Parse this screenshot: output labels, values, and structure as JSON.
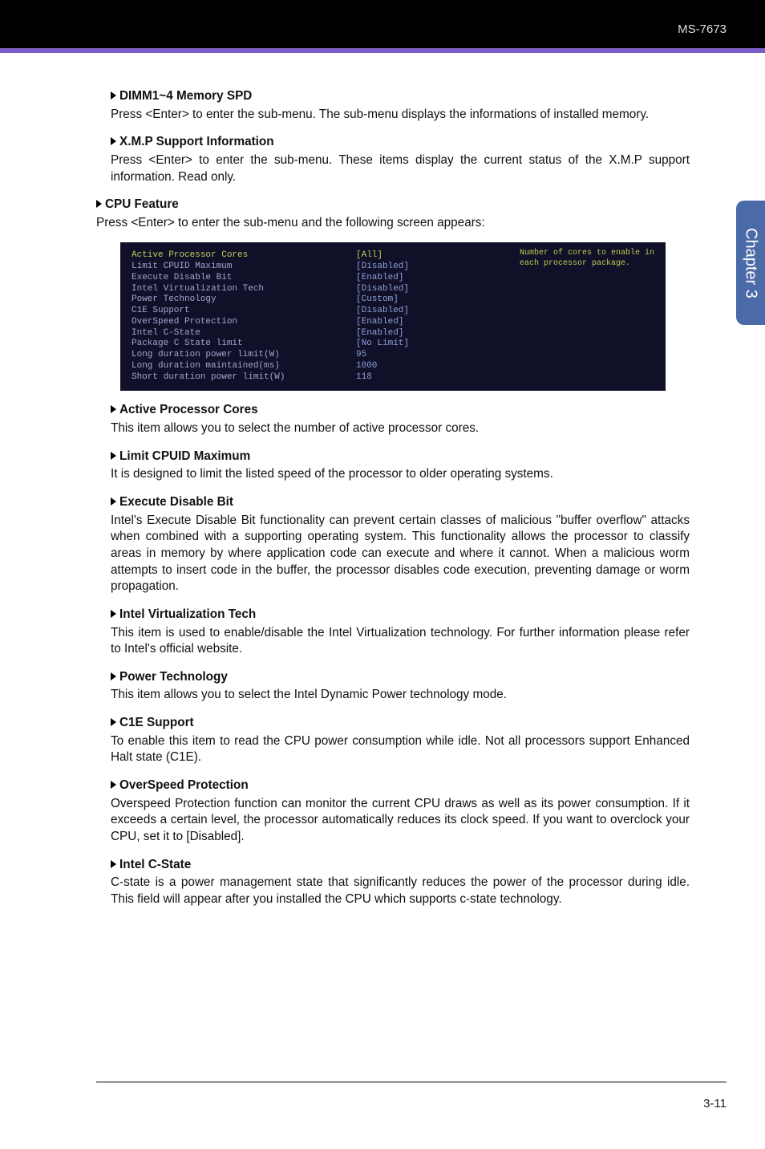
{
  "header": {
    "model": "MS-7673"
  },
  "sidebar": {
    "label": "Chapter 3"
  },
  "sections": {
    "dimm": {
      "title": "DIMM1~4 Memory SPD",
      "body": "Press <Enter> to enter the sub-menu. The sub-menu displays the informations of installed memory."
    },
    "xmp": {
      "title": "X.M.P Support Information",
      "body": "Press <Enter> to enter the sub-menu. These items display the current status of the X.M.P support information. Read only."
    },
    "cpu_feature": {
      "title": "CPU Feature",
      "body": "Press <Enter> to enter the sub-menu and the following screen appears:"
    },
    "active_cores": {
      "title": "Active Processor Cores",
      "body": "This item allows you to select the number of active processor cores."
    },
    "limit_cpuid": {
      "title": "Limit CPUID Maximum",
      "body": "It is designed to limit the listed speed of the processor to older operating systems."
    },
    "exec_disable": {
      "title": "Execute Disable Bit",
      "body": "Intel's Execute Disable Bit functionality can prevent certain classes of malicious \"buffer overflow\" attacks when combined with a supporting operating system. This functionality allows the processor to classify areas in memory by where application code can execute and where it cannot. When a malicious worm attempts to insert code in the buffer, the processor disables code execution, preventing damage or worm propagation."
    },
    "intel_virt": {
      "title": "Intel Virtualization Tech",
      "body": "This item is used to enable/disable the Intel Virtualization technology. For further information please refer to Intel's official website."
    },
    "power_tech": {
      "title": "Power Technology",
      "body": "This item allows you to select the Intel Dynamic Power technology mode."
    },
    "c1e": {
      "title": "C1E Support",
      "body": "To enable this item to read the CPU power consumption while idle. Not all processors support Enhanced Halt state (C1E)."
    },
    "overspeed": {
      "title": "OverSpeed Protection",
      "body": "Overspeed Protection function can monitor the current CPU draws as well as its power consumption. If it exceeds a certain level, the processor automatically reduces its clock speed. If you want to overclock your CPU, set it to [Disabled]."
    },
    "intel_cstate": {
      "title": "Intel C-State",
      "body": "C-state is a power management state that significantly reduces the power of the processor during idle. This field will appear after you installed the CPU which supports c-state technology."
    }
  },
  "bios": {
    "rows": [
      {
        "k": "Active Processor Cores",
        "v": "[All]",
        "hl": true
      },
      {
        "k": "Limit CPUID Maximum",
        "v": "[Disabled]"
      },
      {
        "k": "Execute Disable Bit",
        "v": "[Enabled]"
      },
      {
        "k": "Intel Virtualization Tech",
        "v": "[Disabled]"
      },
      {
        "k": "Power Technology",
        "v": "[Custom]"
      },
      {
        "k": "C1E Support",
        "v": "[Disabled]"
      },
      {
        "k": "OverSpeed Protection",
        "v": "[Enabled]"
      },
      {
        "k": "Intel C-State",
        "v": "[Enabled]"
      },
      {
        "k": "Package C State limit",
        "v": "[No Limit]"
      },
      {
        "k": "Long duration power limit(W)",
        "v": "95"
      },
      {
        "k": "Long duration maintained(ms)",
        "v": "1000"
      },
      {
        "k": "Short duration power limit(W)",
        "v": "118"
      }
    ],
    "help": "Number of cores to enable in each processor package."
  },
  "footer": {
    "page": "3-11"
  }
}
